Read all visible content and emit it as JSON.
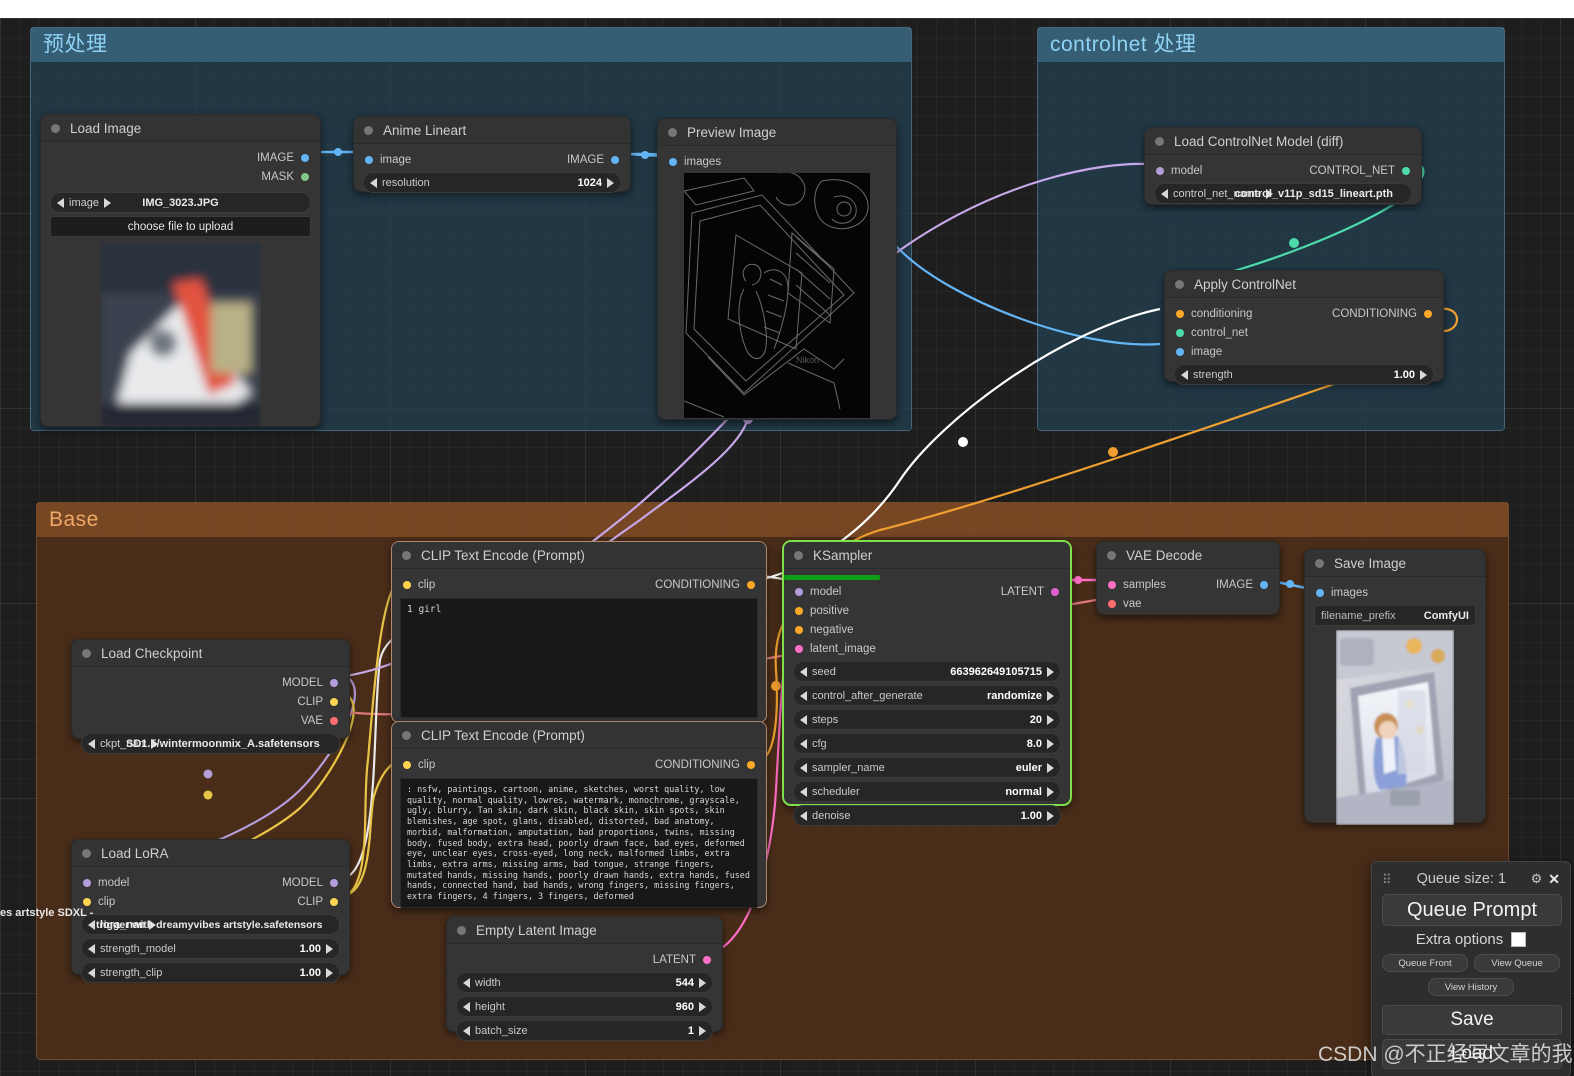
{
  "groups": [
    {
      "title": "预处理"
    },
    {
      "title": "controlnet 处理"
    },
    {
      "title": "Base"
    }
  ],
  "nodes": {
    "load_image": {
      "title": "Load Image",
      "outputs": [
        {
          "label": "IMAGE"
        },
        {
          "label": "MASK"
        }
      ],
      "widget_image_label": "image",
      "widget_image_value": "IMG_3023.JPG",
      "upload_button": "choose file to upload"
    },
    "anime_lineart": {
      "title": "Anime Lineart",
      "input": "image",
      "output": "IMAGE",
      "widget_label": "resolution",
      "widget_value": "1024"
    },
    "preview_image": {
      "title": "Preview Image",
      "input": "images"
    },
    "load_controlnet": {
      "title": "Load ControlNet Model (diff)",
      "input": "model",
      "output": "CONTROL_NET",
      "widget_label": "control_net_name",
      "widget_value": "control_v11p_sd15_lineart.pth"
    },
    "apply_controlnet": {
      "title": "Apply ControlNet",
      "inputs": [
        "conditioning",
        "control_net",
        "image"
      ],
      "output": "CONDITIONING",
      "widget_label": "strength",
      "widget_value": "1.00"
    },
    "clip_positive": {
      "title": "CLIP Text Encode (Prompt)",
      "input": "clip",
      "output": "CONDITIONING",
      "text": "1 girl"
    },
    "clip_negative": {
      "title": "CLIP Text Encode (Prompt)",
      "input": "clip",
      "output": "CONDITIONING",
      "text": ": nsfw, paintings, cartoon, anime, sketches, worst quality, low quality, normal quality, lowres, watermark, monochrome, grayscale, ugly, blurry, Tan skin, dark skin, black skin, skin spots, skin blemishes, age spot, glans, disabled, distorted, bad anatomy, morbid, malformation, amputation, bad proportions, twins, missing body, fused body, extra head, poorly drawn face, bad eyes, deformed eye, unclear eyes, cross-eyed, long neck, malformed limbs, extra limbs, extra arms, missing arms, bad tongue, strange fingers, mutated hands, missing hands, poorly drawn hands, extra hands, fused hands, connected hand, bad hands, wrong fingers, missing fingers, extra fingers, 4 fingers, 3 fingers, deformed"
    },
    "load_checkpoint": {
      "title": "Load Checkpoint",
      "outputs": [
        "MODEL",
        "CLIP",
        "VAE"
      ],
      "widget_label": "ckpt_name",
      "widget_value": "SD1.5/wintermoonmix_A.safetensors"
    },
    "load_lora": {
      "title": "Load LoRA",
      "inputs": [
        "model",
        "clip"
      ],
      "outputs": [
        "MODEL",
        "CLIP"
      ],
      "widget_name_label": "lora_name",
      "widget_name_value": "trigger with dreamyvibes artstyle.safetensors",
      "widget_name_overflow": "es artstyle SDXL -",
      "widgets": [
        {
          "label": "strength_model",
          "value": "1.00"
        },
        {
          "label": "strength_clip",
          "value": "1.00"
        }
      ]
    },
    "ksampler": {
      "title": "KSampler",
      "inputs": [
        "model",
        "positive",
        "negative",
        "latent_image"
      ],
      "output": "LATENT",
      "widgets": [
        {
          "label": "seed",
          "value": "663962649105715"
        },
        {
          "label": "control_after_generate",
          "value": "randomize"
        },
        {
          "label": "steps",
          "value": "20"
        },
        {
          "label": "cfg",
          "value": "8.0"
        },
        {
          "label": "sampler_name",
          "value": "euler"
        },
        {
          "label": "scheduler",
          "value": "normal"
        },
        {
          "label": "denoise",
          "value": "1.00"
        }
      ]
    },
    "empty_latent": {
      "title": "Empty Latent Image",
      "output": "LATENT",
      "widgets": [
        {
          "label": "width",
          "value": "544"
        },
        {
          "label": "height",
          "value": "960"
        },
        {
          "label": "batch_size",
          "value": "1"
        }
      ]
    },
    "vae_decode": {
      "title": "VAE Decode",
      "inputs": [
        "samples",
        "vae"
      ],
      "output": "IMAGE"
    },
    "save_image": {
      "title": "Save Image",
      "input": "images",
      "widget_label": "filename_prefix",
      "widget_value": "ComfyUI"
    }
  },
  "menu": {
    "queue_size": "Queue size: 1",
    "gear_icon": "gear-icon",
    "close_icon": "close-icon",
    "queue_prompt": "Queue Prompt",
    "extra_options": "Extra options",
    "queue_front": "Queue Front",
    "view_queue": "View Queue",
    "view_history": "View History",
    "save": "Save",
    "load": "Load"
  },
  "watermark": "CSDN @不正经写文章的我",
  "colors": {
    "image_slot": "#64b5f6",
    "mask_slot": "#81c784",
    "model_slot": "#b39ddb",
    "clip_slot": "#ffd54f",
    "vae_slot": "#ff6e6e",
    "conditioning_slot": "#ffa726",
    "latent_slot": "#ff6ec7",
    "controlnet_slot": "#4ddbac",
    "group_blue": "#2a495d",
    "group_orange": "#60391d",
    "selected_node": "#7ee04a"
  }
}
